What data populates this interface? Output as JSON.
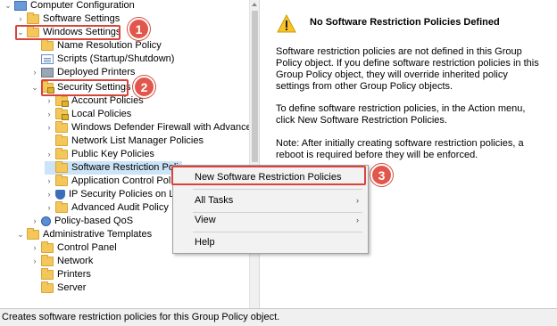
{
  "tree": {
    "items": [
      {
        "label": "Computer Configuration",
        "icon": "computer-icon"
      },
      {
        "label": "Software Settings",
        "icon": "folder-icon"
      },
      {
        "label": "Windows Settings",
        "icon": "folder-icon"
      },
      {
        "label": "Name Resolution Policy",
        "icon": "folder-icon"
      },
      {
        "label": "Scripts (Startup/Shutdown)",
        "icon": "script-icon"
      },
      {
        "label": "Deployed Printers",
        "icon": "printer-icon"
      },
      {
        "label": "Security Settings",
        "icon": "security-folder-icon"
      },
      {
        "label": "Account Policies",
        "icon": "folder-icon"
      },
      {
        "label": "Local Policies",
        "icon": "folder-icon"
      },
      {
        "label": "Windows Defender Firewall with Advanced",
        "icon": "folder-icon"
      },
      {
        "label": "Network List Manager Policies",
        "icon": "folder-icon"
      },
      {
        "label": "Public Key Policies",
        "icon": "folder-icon"
      },
      {
        "label": "Software Restriction Poli",
        "icon": "folder-icon"
      },
      {
        "label": "Application Control Pol",
        "icon": "folder-icon"
      },
      {
        "label": "IP Security Policies on L",
        "icon": "shield-icon"
      },
      {
        "label": "Advanced Audit Policy",
        "icon": "folder-icon"
      },
      {
        "label": "Policy-based QoS",
        "icon": "qos-icon"
      },
      {
        "label": "Administrative Templates",
        "icon": "folder-icon"
      },
      {
        "label": "Control Panel",
        "icon": "folder-icon"
      },
      {
        "label": "Network",
        "icon": "folder-icon"
      },
      {
        "label": "Printers",
        "icon": "folder-icon"
      },
      {
        "label": "Server",
        "icon": "folder-icon"
      }
    ]
  },
  "detail": {
    "heading": "No Software Restriction Policies Defined",
    "para1": "Software restriction policies are not defined in this Group Policy object. If you define software restriction policies in this Group Policy object, they will override inherited policy settings from other Group Policy objects.",
    "para2": "To define software restriction policies, in the Action menu, click New Software Restriction Policies.",
    "para3": "Note: After initially creating software restriction policies, a reboot is required before they will be enforced."
  },
  "context_menu": {
    "items": [
      "New Software Restriction Policies",
      "All Tasks",
      "View",
      "Help"
    ]
  },
  "badges": [
    "1",
    "2",
    "3"
  ],
  "status": "Creates software restriction policies for this Group Policy object.",
  "colors": {
    "annotation_red": "#d9443a",
    "badge_fill": "#e2574c",
    "folder": "#f3c75a"
  }
}
